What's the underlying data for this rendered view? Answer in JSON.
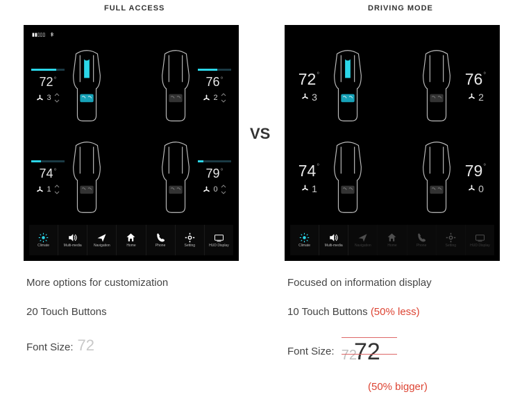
{
  "headers": {
    "left": "FULL ACCESS",
    "right": "DRIVING MODE"
  },
  "vs": "VS",
  "statusbar": {
    "signal": "𝗜𝗜𝗹𝗹",
    "wifi": "wifi",
    "bt": "bt"
  },
  "seats": {
    "fl": {
      "temp": "72",
      "fan": "3",
      "barFill": 36
    },
    "fr": {
      "temp": "76",
      "fan": "2",
      "barFill": 28
    },
    "rl": {
      "temp": "74",
      "fan": "1",
      "barFill": 14
    },
    "rr": {
      "temp": "79",
      "fan": "0",
      "barFill": 8
    }
  },
  "nav": [
    {
      "key": "climate",
      "label": "Climate",
      "icon": "sun"
    },
    {
      "key": "media",
      "label": "Multi-media",
      "icon": "sound"
    },
    {
      "key": "navi",
      "label": "Navigation",
      "icon": "nav"
    },
    {
      "key": "home",
      "label": "Home",
      "icon": "home"
    },
    {
      "key": "phone",
      "label": "Phone",
      "icon": "phone"
    },
    {
      "key": "setting",
      "label": "Setting",
      "icon": "gear"
    },
    {
      "key": "hud",
      "label": "HUD Display",
      "icon": "hud"
    }
  ],
  "drivingDim": [
    "navi",
    "home",
    "phone",
    "setting",
    "hud"
  ],
  "notes": {
    "leftLine1": "More options for customization",
    "leftLine2": "20 Touch Buttons",
    "leftFontLabel": "Font Size:",
    "leftFontValue": "72",
    "rightLine1": "Focused on information display",
    "rightLine2a": "10 Touch Buttons ",
    "rightLine2b": "(50% less)",
    "rightFontLabel": "Font Size:",
    "rightFontSmall": "72",
    "rightFontBig": "72",
    "rightBigger": "(50% bigger)"
  }
}
